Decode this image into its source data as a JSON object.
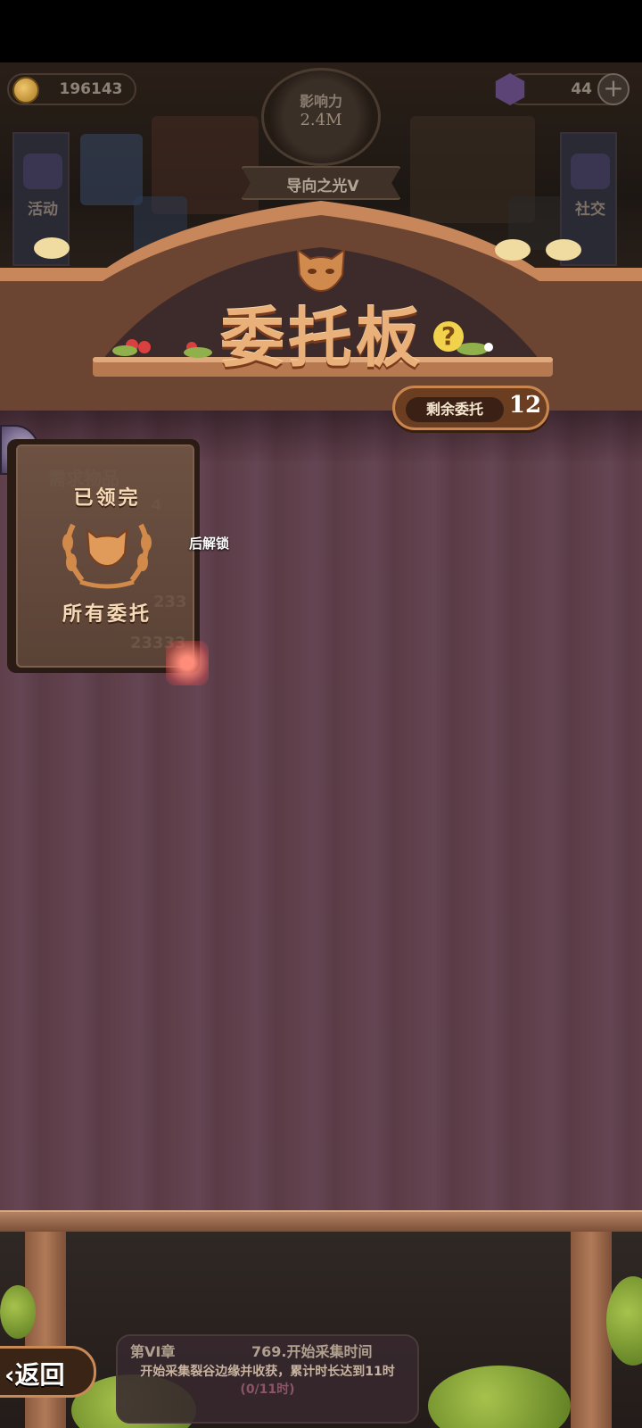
{
  "currency": {
    "coins": "196143",
    "gems": "44",
    "add_gems_symbol": "+"
  },
  "influence": {
    "label": "影响力",
    "value": "2.4M",
    "rank": "导向之光V"
  },
  "side_menu": {
    "left_label": "活动",
    "right_label": "社交"
  },
  "board": {
    "title": "委托板",
    "help_symbol": "?",
    "remaining_label": "剩余委托",
    "remaining_count": "12"
  },
  "completion_card": {
    "status": "已领完",
    "caption": "所有委托",
    "bg_text_1": "需求物品",
    "bg_text_2": "4",
    "bg_text_3": "233",
    "bg_text_4": "23333"
  },
  "unlock_hint": "后解锁",
  "back_button": "返回",
  "quest": {
    "chapter": "第VI章",
    "title": "769.开始采集时间",
    "description": "开始采集裂谷边缘并收获，累计时长达到11时",
    "progress": "(0/11时)"
  },
  "colors": {
    "title": "#e9b07a",
    "board": "#5e3f4a",
    "accent_wood": "#c9874f"
  }
}
